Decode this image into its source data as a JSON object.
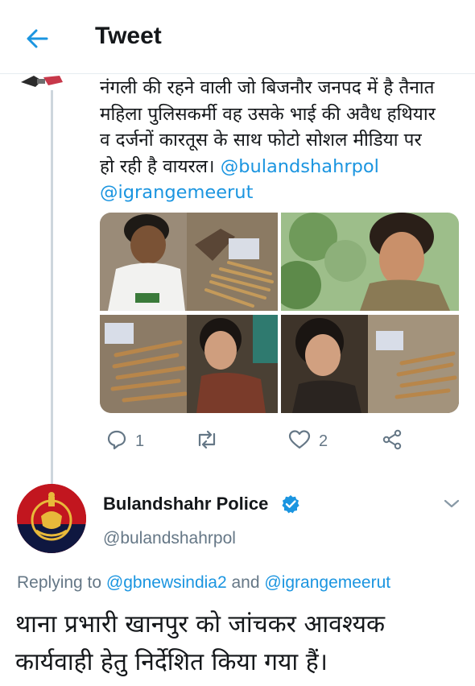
{
  "header": {
    "title": "Tweet",
    "back_icon": "arrow-left-icon"
  },
  "parent_tweet": {
    "text_lines": [
      "नंगली की रहने वाली जो बिजनौर जनपद में है तैनात",
      "महिला पुलिसकर्मी वह उसके भाई की अवैध हथियार",
      "व दर्जनों  कारतूस के साथ फोटो सोशल मीडिया पर"
    ],
    "text_tail": "हो रही है वायरल। ",
    "mention_1": "@bulandshahrpol",
    "mention_2": "@igrangemeerut",
    "actions": {
      "reply_count": "1",
      "like_count": "2"
    }
  },
  "reply_tweet": {
    "name": "Bulandshahr Police",
    "handle": "@bulandshahrpol",
    "replying_prefix": "Replying to ",
    "replying_to_1": "@gbnewsindia2",
    "replying_and": " and ",
    "replying_to_2": "@igrangemeerut",
    "text_line_1": "थाना प्रभारी खानपुर को जांचकर आवश्यक",
    "text_line_2": "कार्यवाही हेतु निर्देशित किया गया हैं।"
  },
  "colors": {
    "accent": "#1b95e0",
    "muted": "#657786",
    "text": "#14171a",
    "police_red": "#c2161f"
  }
}
